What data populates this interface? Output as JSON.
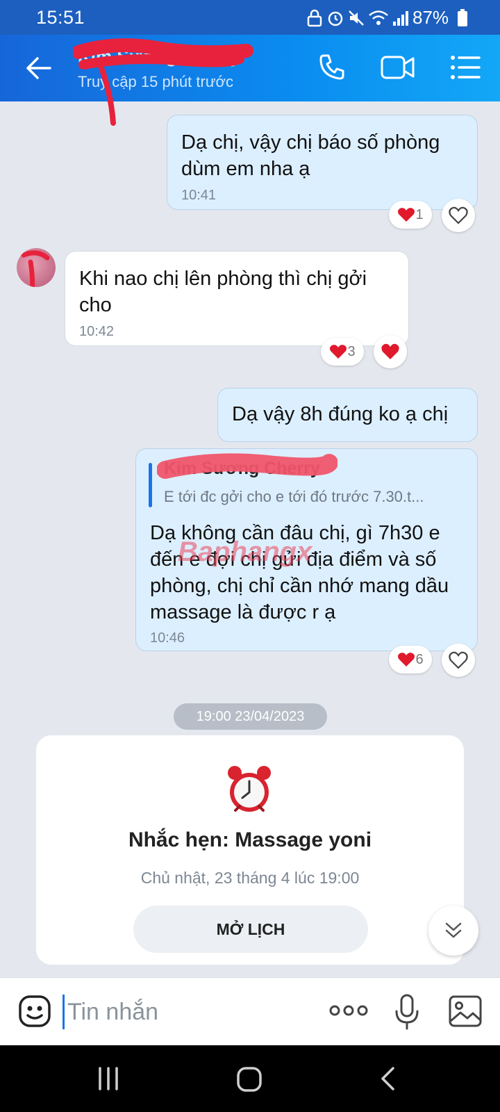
{
  "status_bar": {
    "time": "15:51",
    "battery": "87%"
  },
  "header": {
    "contact_name": "Kim Sương Cherry",
    "last_seen": "Truy cập 15 phút trước"
  },
  "messages": [
    {
      "text": "Dạ chị, vậy chị báo số phòng dùm em nha ạ",
      "time": "10:41",
      "reaction_count": "1"
    },
    {
      "text": "Khi nao chị lên phòng thì chị gởi cho",
      "time": "10:42",
      "reaction_count": "3"
    },
    {
      "text": "Dạ vậy 8h đúng ko ạ chị"
    },
    {
      "quote_author": "Kim Sương Cherry",
      "quote_text": "E tới đc gởi cho e tới đó trước 7.30.t...",
      "text": "Dạ không cần đâu chị, gì 7h30 e đến e đợi chị gửi địa điểm và số phòng, chị chỉ cần nhớ mang dầu massage là được r ạ",
      "time": "10:46",
      "reaction_count": "6"
    }
  ],
  "watermark": "Baphangx",
  "date_separator": "19:00 23/04/2023",
  "reminder": {
    "title": "Nhắc hẹn: Massage yoni",
    "subtitle": "Chủ nhật, 23 tháng 4 lúc 19:00",
    "button": "MỞ LỊCH"
  },
  "input": {
    "placeholder": "Tin nhắn"
  },
  "colors": {
    "header": "#1766d9",
    "outgoing_bubble": "#dcefff",
    "heart": "#e0192c"
  },
  "icons": [
    "back-arrow-icon",
    "phone-icon",
    "video-call-icon",
    "menu-list-icon",
    "heart-icon",
    "alarm-clock-icon",
    "chevron-double-down-icon",
    "sticker-icon",
    "more-dots-icon",
    "microphone-icon",
    "image-icon",
    "recent-apps-icon",
    "home-icon",
    "nav-back-icon"
  ]
}
